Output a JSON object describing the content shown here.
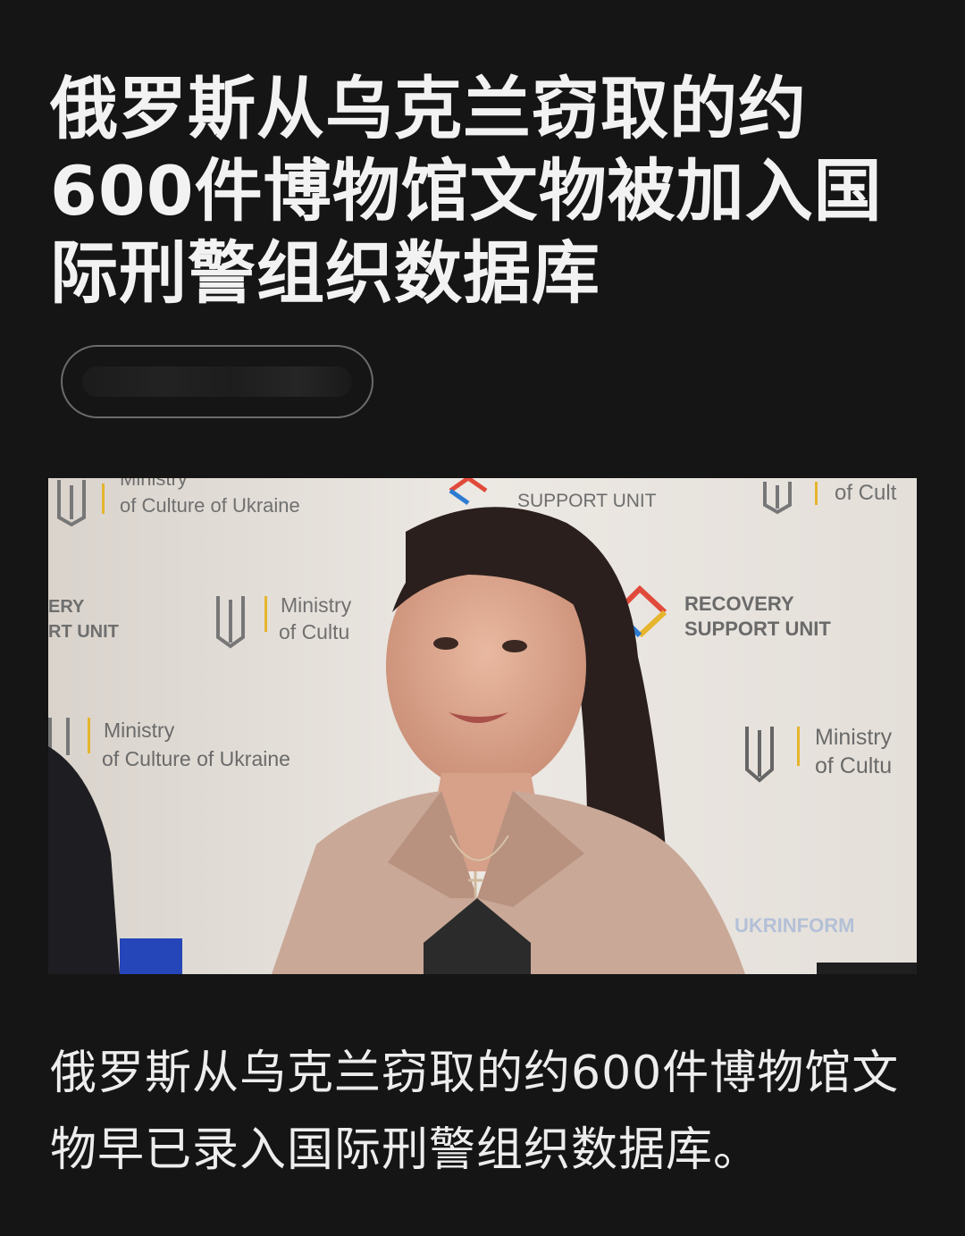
{
  "article": {
    "headline": "俄罗斯从乌克兰窃取的约600件博物馆文物被加入国际刑警组织数据库",
    "caption": "俄罗斯从乌克兰窃取的约600件博物馆文物早已录入国际刑警组织数据库。"
  },
  "photo": {
    "backdrop": {
      "ministry_line1": "Ministry",
      "ministry_line2": "of Culture of Ukraine",
      "ministry_line2_short": "of Cultu",
      "ministry_top_partial": "Ministry",
      "ministry_top_right": "of Cult",
      "recovery_line1": "RECOVERY",
      "recovery_line2": "SUPPORT UNIT",
      "recovery_partial1": "ERY",
      "recovery_partial2": "RT UNIT"
    },
    "watermark": "UKRINFORM"
  },
  "colors": {
    "background": "#151515",
    "text": "#f2f2f2",
    "pill_border": "#6b6b6b",
    "blazer": "#c9a898"
  }
}
